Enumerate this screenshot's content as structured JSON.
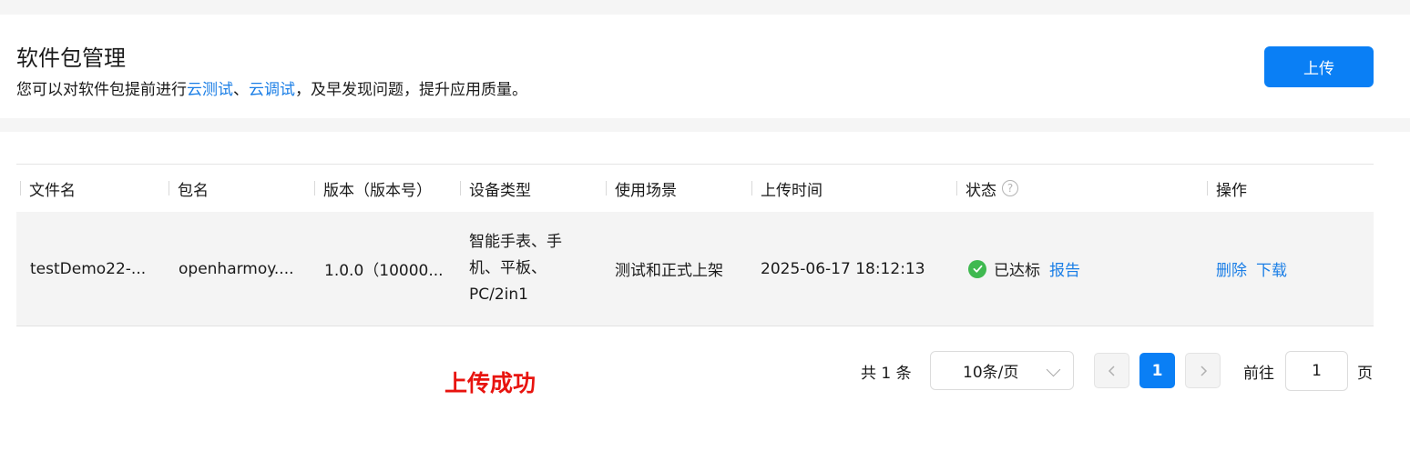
{
  "header": {
    "title": "软件包管理",
    "subtitle_prefix": "您可以对软件包提前进行",
    "link_cloud_test": "云测试",
    "separator": "、",
    "link_cloud_debug": "云调试",
    "subtitle_suffix": "，及早发现问题，提升应用质量。",
    "upload_label": "上传"
  },
  "table": {
    "columns": [
      "文件名",
      "包名",
      "版本（版本号）",
      "设备类型",
      "使用场景",
      "上传时间",
      "状态",
      "操作"
    ],
    "rows": [
      {
        "file_name": "testDemo22-...",
        "package_name": "openharmoy....",
        "version": "1.0.0（10000...",
        "device_types": [
          "智能手表、手",
          "机、平板、",
          "PC/2in1"
        ],
        "scenario": "测试和正式上架",
        "upload_time": "2025-06-17 18:12:13",
        "status": "已达标",
        "report_link": "报告",
        "action_delete": "删除",
        "action_download": "下载"
      }
    ]
  },
  "pagination": {
    "total": "共 1 条",
    "page_size": "10条/页",
    "current_page": "1",
    "goto_label": "前往",
    "goto_value": "1",
    "goto_unit": "页"
  },
  "toast": {
    "message": "上传成功"
  },
  "colors": {
    "primary": "#0a7ff5",
    "link": "#1a7ee6",
    "success_icon": "#3fb950",
    "success_text": "#e8140f"
  },
  "icons": {
    "help": "question-circle-icon",
    "status": "check-circle-icon",
    "prev": "chevron-left-icon",
    "next": "chevron-right-icon",
    "dropdown": "chevron-down-icon"
  }
}
